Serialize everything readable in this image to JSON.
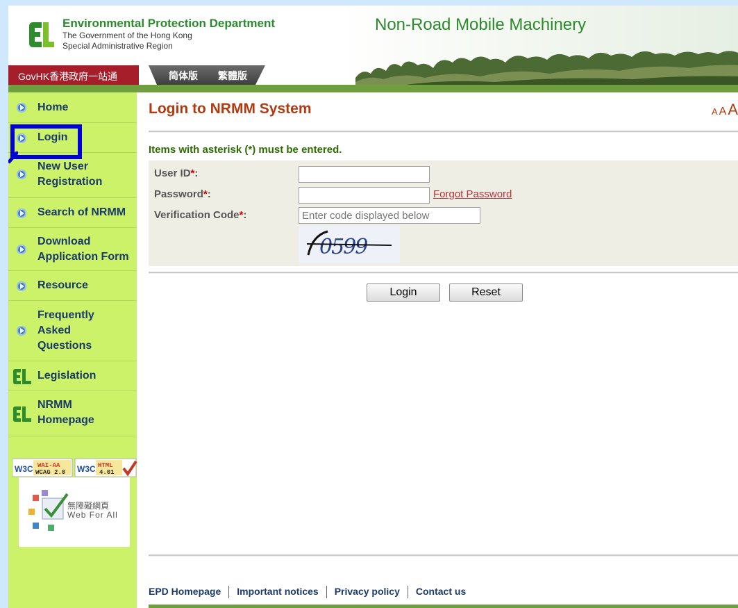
{
  "header": {
    "dept_name": "Environmental Protection Department",
    "gov_line1": "The Government of the Hong Kong",
    "gov_line2": "Special Administrative Region",
    "site_title": "Non-Road Mobile Machinery",
    "govhk_link": "GovHK香港政府一站通",
    "lang_simplified": "简体版",
    "lang_traditional": "繁體版"
  },
  "sidebar": {
    "items": [
      {
        "label": "Home"
      },
      {
        "label": "Login"
      },
      {
        "label": "New User Registration"
      },
      {
        "label": "Search of NRMM"
      },
      {
        "label": "Download Application Form"
      },
      {
        "label": "Resource"
      },
      {
        "label": "Frequently Asked Questions"
      },
      {
        "label": "Legislation"
      },
      {
        "label": "NRMM Homepage"
      }
    ],
    "badges": {
      "w3c_wai": "W3C WAI-AA WCAG 2.0",
      "w3c_html": "W3C HTML 4.01",
      "webforall_cn": "無障礙網頁",
      "webforall_en": "Web For All"
    }
  },
  "main": {
    "title": "Login to NRMM System",
    "font_sizer": [
      "A",
      "A",
      "A"
    ],
    "asterisk_note": "Items with asterisk (*) must be entered.",
    "form": {
      "user_id_label": "User ID",
      "password_label": "Password",
      "verification_label": "Verification Code",
      "required_mark": "*",
      "label_colon": ":",
      "user_id_value": "",
      "password_value": "",
      "verification_placeholder": "Enter code displayed below",
      "forgot_password": "Forgot Password",
      "captcha_text": "0599"
    },
    "buttons": {
      "login": "Login",
      "reset": "Reset"
    }
  },
  "footer": {
    "links": [
      "EPD Homepage",
      "Important notices",
      "Privacy policy",
      "Contact us"
    ]
  },
  "colors": {
    "background": "#cfe8fb",
    "sidebar": "#ccf26a",
    "title_red": "#b23a11",
    "link_blue": "#1a3a6b",
    "green_bar": "#6f9e3f",
    "highlight": "#0000d8"
  }
}
